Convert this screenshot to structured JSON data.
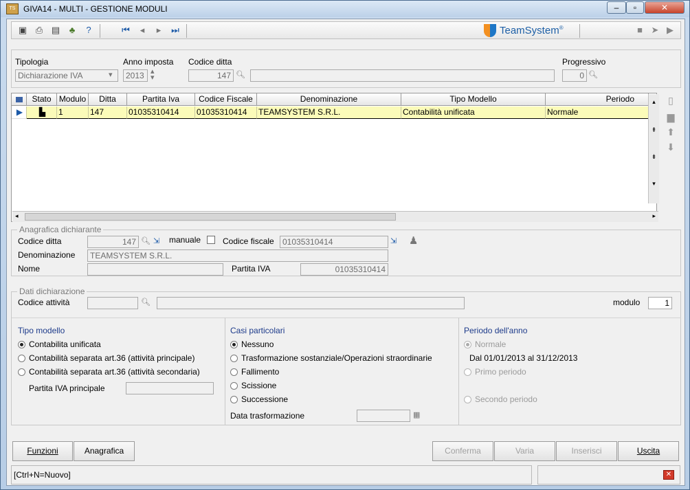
{
  "window": {
    "title": "GIVA14  - MULTI -  GESTIONE MODULI",
    "minimize": "–",
    "maximize": "▫",
    "close": "✕"
  },
  "toolbar": {
    "brand": "TeamSystem",
    "brand_mark": "®"
  },
  "filters": {
    "tipologia_label": "Tipologia",
    "tipologia_value": "Dichiarazione IVA",
    "anno_label": "Anno imposta",
    "anno_value": "2013",
    "codice_ditta_label": "Codice ditta",
    "codice_ditta_value": "147",
    "codice_ditta_desc": "",
    "progressivo_label": "Progressivo",
    "progressivo_value": "0"
  },
  "grid": {
    "columns": [
      "Stato",
      "Modulo",
      "Ditta",
      "Partita Iva",
      "Codice Fiscale",
      "Denominazione",
      "Tipo Modello",
      "Periodo"
    ],
    "rows": [
      {
        "modulo": "1",
        "ditta": "147",
        "partita_iva": "01035310414",
        "codice_fiscale": "01035310414",
        "denominazione": "TEAMSYSTEM S.R.L.",
        "tipo_modello": "Contabilità unificata",
        "periodo": "Normale"
      }
    ]
  },
  "anagrafica": {
    "title": "Anagrafica dichiarante",
    "codice_ditta_label": "Codice ditta",
    "codice_ditta_value": "147",
    "manuale_label": "manuale",
    "codice_fiscale_label": "Codice fiscale",
    "codice_fiscale_value": "01035310414",
    "denominazione_label": "Denominazione",
    "denominazione_value": "TEAMSYSTEM S.R.L.",
    "nome_label": "Nome",
    "nome_value": "",
    "partita_iva_label": "Partita IVA",
    "partita_iva_value": "01035310414"
  },
  "dichiarazione": {
    "title": "Dati dichiarazione",
    "codice_attivita_label": "Codice attività",
    "codice_attivita_value": "",
    "modulo_label": "modulo",
    "modulo_value": "1",
    "tipo_modello": {
      "title": "Tipo modello",
      "options": [
        "Contabilita unificata",
        "Contabilità separata art.36 (attività principale)",
        "Contabilità separata art.36 (attività secondaria)"
      ],
      "partita_iva_principale_label": "Partita IVA principale"
    },
    "casi_particolari": {
      "title": "Casi particolari",
      "options": [
        "Nessuno",
        "Trasformazione sostanziale/Operazioni straordinarie",
        "Fallimento",
        "Scissione",
        "Successione"
      ],
      "data_trasformazione_label": "Data trasformazione"
    },
    "periodo": {
      "title": "Periodo dell'anno",
      "normale": "Normale",
      "range": "Dal 01/01/2013 al 31/12/2013",
      "primo": "Primo periodo",
      "secondo": "Secondo periodo"
    }
  },
  "buttons": {
    "funzioni": "Funzioni",
    "anagrafica": "Anagrafica",
    "conferma": "Conferma",
    "varia": "Varia",
    "inserisci": "Inserisci",
    "uscita": "Uscita"
  },
  "status": {
    "hint": "[Ctrl+N=Nuovo]"
  }
}
